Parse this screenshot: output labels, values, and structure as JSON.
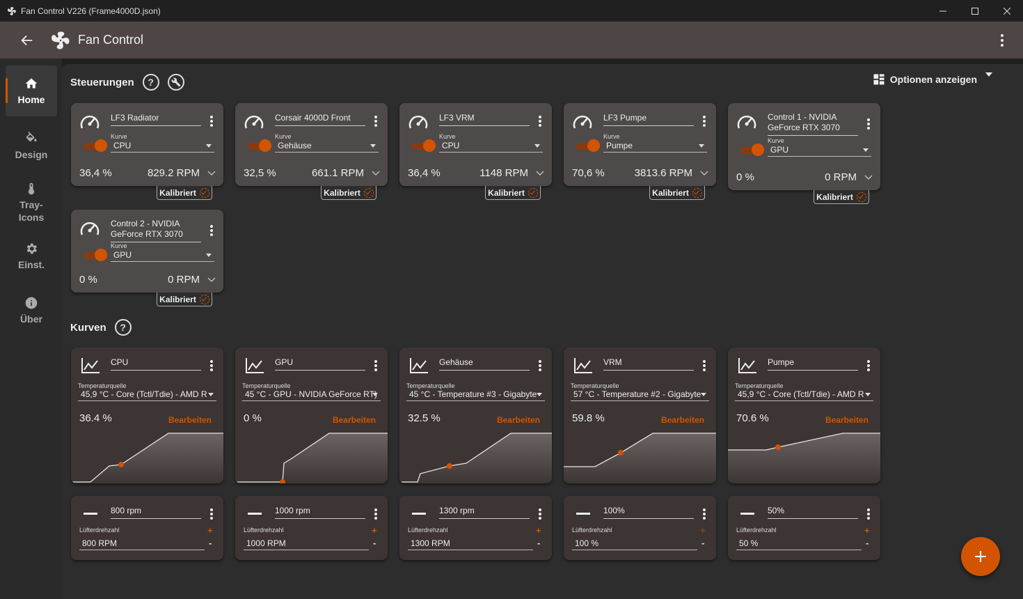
{
  "window": {
    "title": "Fan Control V226 (Frame4000D.json)"
  },
  "appbar": {
    "title": "Fan Control"
  },
  "sidebar": {
    "items": [
      {
        "label": "Home",
        "icon": "home-icon"
      },
      {
        "label": "Design",
        "icon": "paint-bucket-icon"
      },
      {
        "label": "Tray-\nIcons",
        "icon": "thermometer-icon"
      },
      {
        "label": "Einst.",
        "icon": "gear-icon"
      },
      {
        "label": "Über",
        "icon": "info-icon"
      }
    ]
  },
  "sections": {
    "controls_title": "Steuerungen",
    "curves_title": "Kurven",
    "help": "?",
    "options_label": "Optionen anzeigen"
  },
  "accent": "#d35400",
  "controls": [
    {
      "name": "LF3 Radiator",
      "curve_label": "Kurve",
      "curve": "CPU",
      "percent": "36,4 %",
      "rpm": "829.2 RPM",
      "badge": "Kalibriert"
    },
    {
      "name": "Corsair 4000D Front",
      "curve_label": "Kurve",
      "curve": "Gehäuse",
      "percent": "32,5 %",
      "rpm": "661.1 RPM",
      "badge": "Kalibriert"
    },
    {
      "name": "LF3 VRM",
      "curve_label": "Kurve",
      "curve": "CPU",
      "percent": "36,4 %",
      "rpm": "1148 RPM",
      "badge": "Kalibriert"
    },
    {
      "name": "LF3 Pumpe",
      "curve_label": "Kurve",
      "curve": "Pumpe",
      "percent": "70,6 %",
      "rpm": "3813.6 RPM",
      "badge": "Kalibriert"
    },
    {
      "name": "Control 1 - NVIDIA GeForce RTX 3070",
      "curve_label": "Kurve",
      "curve": "GPU",
      "percent": "0 %",
      "rpm": "0 RPM",
      "badge": "Kalibriert"
    },
    {
      "name": "Control 2 - NVIDIA GeForce RTX 3070",
      "curve_label": "Kurve",
      "curve": "GPU",
      "percent": "0 %",
      "rpm": "0 RPM",
      "badge": "Kalibriert"
    }
  ],
  "curves": [
    {
      "name": "CPU",
      "source_label": "Temperaturquelle",
      "source": "45,9 °C - Core (Tctl/Tdie) - AMD R",
      "value": "36.4 %",
      "edit": "Bearbeiten"
    },
    {
      "name": "GPU",
      "source_label": "Temperaturquelle",
      "source": "45 °C - GPU - NVIDIA GeForce RT)",
      "value": "0 %",
      "edit": "Bearbeiten"
    },
    {
      "name": "Gehäuse",
      "source_label": "Temperaturquelle",
      "source": "45 °C - Temperature #3 - Gigabyte",
      "value": "32.5 %",
      "edit": "Bearbeiten"
    },
    {
      "name": "VRM",
      "source_label": "Temperaturquelle",
      "source": "57 °C - Temperature #2 - Gigabyte",
      "value": "59.8 %",
      "edit": "Bearbeiten"
    },
    {
      "name": "Pumpe",
      "source_label": "Temperaturquelle",
      "source": "45,9 °C - Core (Tctl/Tdie) - AMD R",
      "value": "70.6 %",
      "edit": "Bearbeiten"
    }
  ],
  "fixed": [
    {
      "name": "800 rpm",
      "label": "Lüfterdrehzahl",
      "value": "800 RPM",
      "plus": "+",
      "minus": "-"
    },
    {
      "name": "1000 rpm",
      "label": "Lüfterdrehzahl",
      "value": "1000 RPM",
      "plus": "+",
      "minus": "-"
    },
    {
      "name": "1300 rpm",
      "label": "Lüfterdrehzahl",
      "value": "1300 RPM",
      "plus": "+",
      "minus": "-"
    },
    {
      "name": "100%",
      "label": "Lüfterdrehzahl",
      "value": "100 %",
      "plus": "+",
      "minus": "-"
    },
    {
      "name": "50%",
      "label": "Lüfterdrehzahl",
      "value": "50 %",
      "plus": "+",
      "minus": "-"
    }
  ]
}
